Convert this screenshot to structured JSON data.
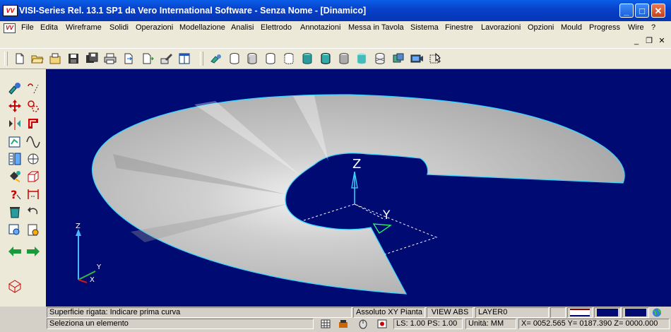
{
  "window": {
    "title": "VISI-Series Rel. 13.1 SP1 da Vero International Software - Senza Nome - [Dinamico]",
    "logo_text": "VV",
    "minimize": "_",
    "maximize": "□",
    "close": "✕"
  },
  "menu": {
    "items": [
      "File",
      "Edita",
      "Wireframe",
      "Solidi",
      "Operazioni",
      "Modellazione",
      "Analisi",
      "Elettrodo",
      "Annotazioni",
      "Messa in Tavola",
      "Sistema",
      "Finestre",
      "Lavorazioni",
      "Opzioni",
      "Mould",
      "Progress",
      "Wire",
      "?"
    ]
  },
  "mdi": {
    "minimize": "_",
    "restore": "❐",
    "close": "✕"
  },
  "toolbar": {
    "icons": [
      "new-file-icon",
      "open-folder-icon",
      "open-archive-icon",
      "save-icon",
      "save-all-icon",
      "print-icon",
      "export-icon",
      "import-icon",
      "edit-icon",
      "layout-icon",
      "cylinder-wire-icon",
      "cylinder-hidden-icon",
      "cylinder-shaded-icon",
      "cylinder-outline-icon",
      "cylinder-dashed-icon",
      "cylinder-teal-icon",
      "cylinder-teal-edges-icon",
      "cylinder-grey-icon",
      "cylinder-dotted-icon",
      "cylinder-mesh-icon",
      "render-box-icon",
      "camera-icon",
      "selection-icon"
    ]
  },
  "sidebar": {
    "icons": [
      "wrench-tool-icon",
      "disconnect-icon",
      "move-icon",
      "rotate-icon",
      "mirror-icon",
      "offset-icon",
      "sketch-icon",
      "curve-icon",
      "layers-icon",
      "grid-icon",
      "paint-icon",
      "box-icon",
      "query-icon",
      "measure-icon",
      "delete-icon",
      "undo-icon",
      "zoom-box-icon",
      "zoom-page-icon",
      "arrow-left-icon",
      "arrow-right-icon",
      "view-cube-icon"
    ]
  },
  "viewport": {
    "axis_labels": {
      "z": "Z",
      "y": "Y",
      "x": "X"
    },
    "colors": {
      "background": "#000a73",
      "surface": "#a8a8a8",
      "edge": "#3ad6ff"
    }
  },
  "status": {
    "prompt": "Superficie rigata: Indicare prima curva",
    "hint": "Seleziona un elemento",
    "coord_system": "Assoluto XY Pianta",
    "view_mode": "VIEW ABS",
    "layer": "LAYER0",
    "ls_ps": "LS: 1.00 PS: 1.00",
    "units": "Unità: MM",
    "coordinates": "X=  0052.565 Y=  0187.390 Z=  0000.000"
  }
}
